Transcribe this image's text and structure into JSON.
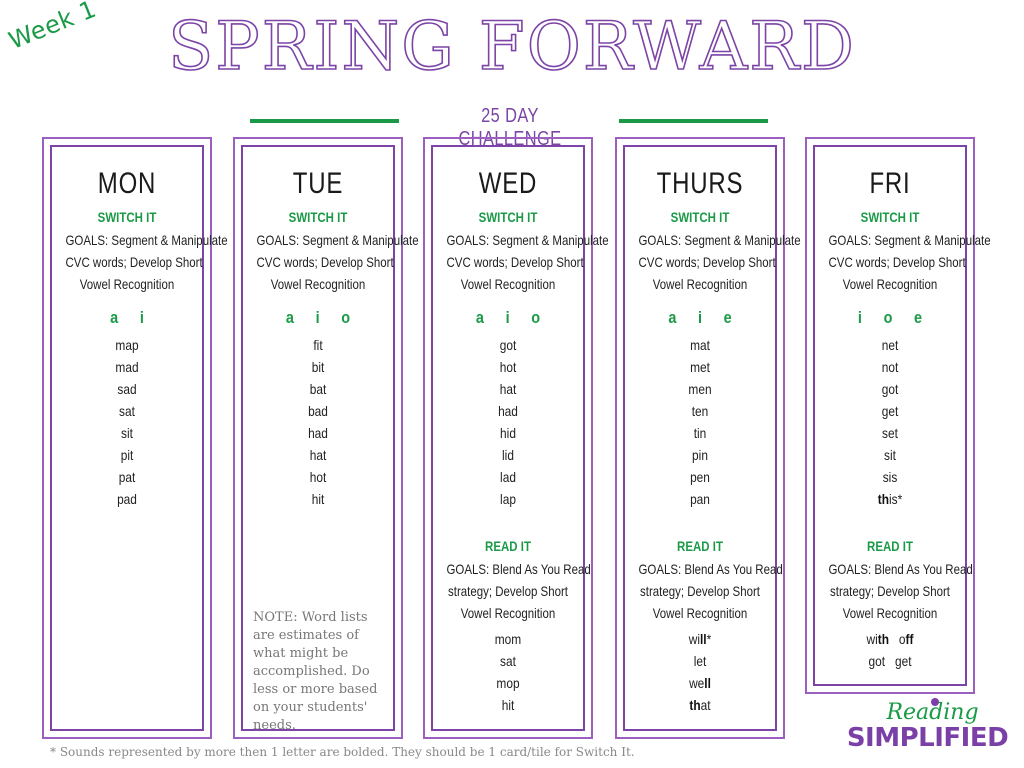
{
  "header": {
    "week_label": "Week 1",
    "title": "SPRING FORWARD",
    "subtitle": "25 DAY CHALLENGE"
  },
  "colors": {
    "purple": "#7b44a6",
    "green": "#1a9a46",
    "text": "#222222"
  },
  "days": [
    {
      "name": "MON",
      "switch_it": {
        "label": "SWITCH IT",
        "goals": [
          "GOALS: Segment & Manipulate",
          "CVC words; Develop Short",
          "Vowel Recognition"
        ],
        "vowels": "a  i",
        "words": [
          "map",
          "mad",
          "sad",
          "sat",
          "sit",
          "pit",
          "pat",
          "pad"
        ]
      }
    },
    {
      "name": "TUE",
      "switch_it": {
        "label": "SWITCH IT",
        "goals": [
          "GOALS: Segment & Manipulate",
          "CVC words; Develop Short",
          "Vowel Recognition"
        ],
        "vowels": "a  i  o",
        "words": [
          "fit",
          "bit",
          "bat",
          "bad",
          "had",
          "hat",
          "hot",
          "hit"
        ]
      },
      "note": "NOTE: Word lists are estimates of what might be accomplished.  Do less or more based on your students' needs."
    },
    {
      "name": "WED",
      "switch_it": {
        "label": "SWITCH IT",
        "goals": [
          "GOALS: Segment & Manipulate",
          "CVC words; Develop Short",
          "Vowel Recognition"
        ],
        "vowels": "a  i  o",
        "words": [
          "got",
          "hot",
          "hat",
          "had",
          "hid",
          "lid",
          "lad",
          "lap"
        ]
      },
      "read_it": {
        "label": "READ IT",
        "goals": [
          "GOALS: Blend As You Read",
          "strategy; Develop Short",
          "Vowel Recognition"
        ],
        "words": [
          "mom",
          "sat",
          "mop",
          "hit"
        ]
      }
    },
    {
      "name": "THURS",
      "switch_it": {
        "label": "SWITCH IT",
        "goals": [
          "GOALS: Segment & Manipulate",
          "CVC words; Develop Short",
          "Vowel Recognition"
        ],
        "vowels": "a  i  e",
        "words": [
          "mat",
          "met",
          "men",
          "ten",
          "tin",
          "pin",
          "pen",
          "pan"
        ]
      },
      "read_it": {
        "label": "READ IT",
        "goals": [
          "GOALS: Blend As You Read",
          "strategy; Develop Short",
          "Vowel Recognition"
        ],
        "words": [
          "wi|ll|*",
          "let",
          "we|ll|",
          "|th|at"
        ]
      }
    },
    {
      "name": "FRI",
      "switch_it": {
        "label": "SWITCH IT",
        "goals": [
          "GOALS: Segment & Manipulate",
          "CVC words; Develop Short",
          "Vowel Recognition"
        ],
        "vowels": "i  o  e",
        "words": [
          "net",
          "not",
          "got",
          "get",
          "set",
          "sit",
          "sis",
          "|th|is*"
        ]
      },
      "read_it": {
        "label": "READ IT",
        "goals": [
          "GOALS: Blend As You Read",
          "strategy; Develop Short",
          "Vowel Recognition"
        ],
        "words": [
          "wi|th|   o|ff|",
          "got   get"
        ]
      }
    }
  ],
  "footnote": "* Sounds represented by more then 1 letter are bolded.  They should be 1 card/tile for Switch It.",
  "logo": {
    "line1": "Reading",
    "line2": "SIMPLIFIED"
  }
}
